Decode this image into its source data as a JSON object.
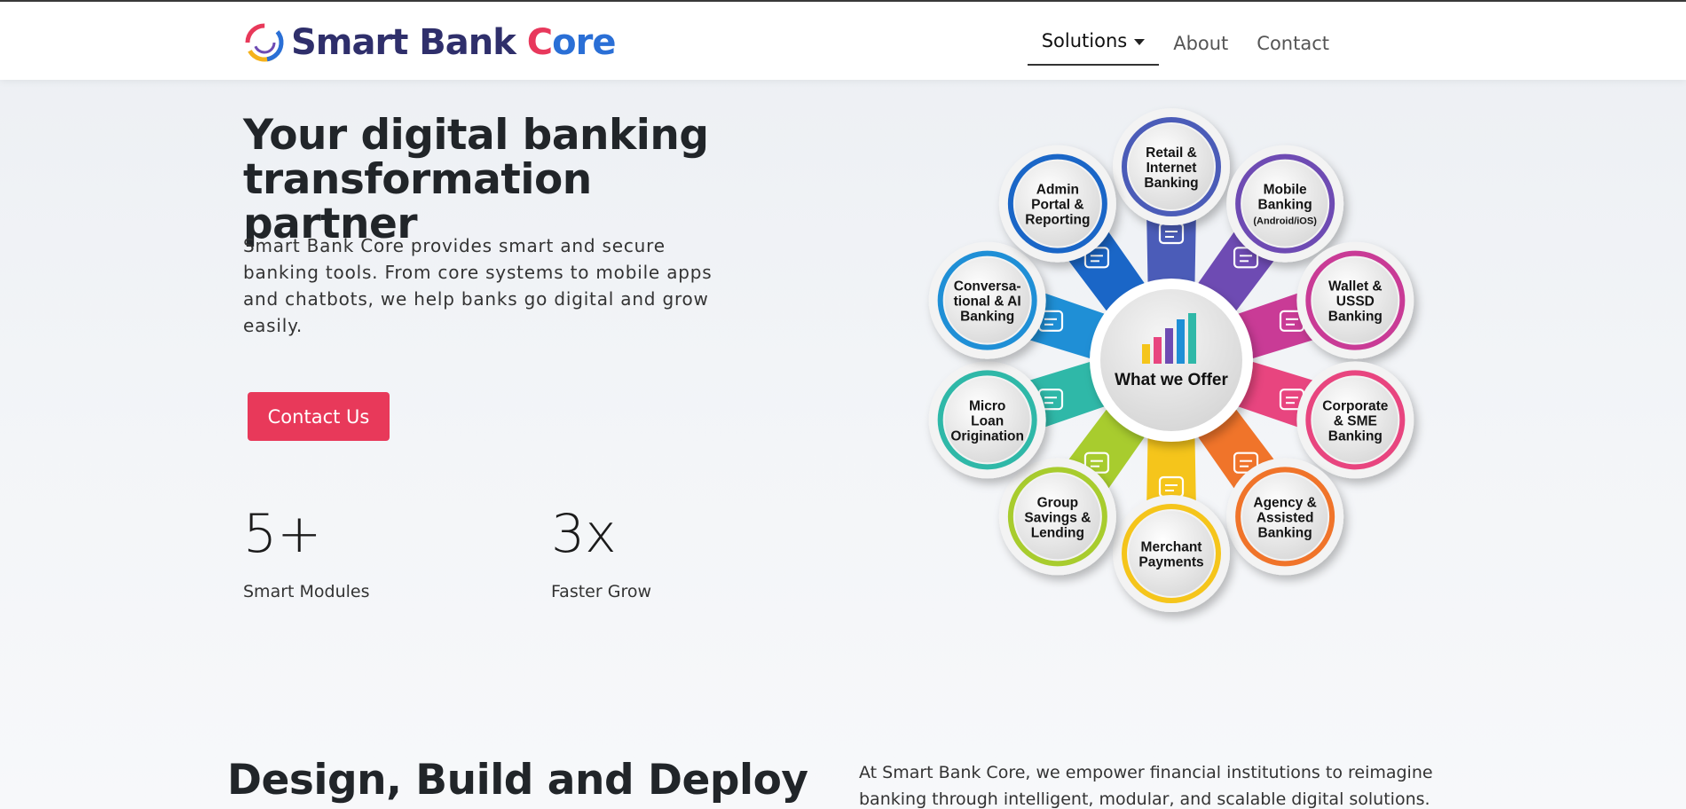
{
  "brand": {
    "name_part1": "Smart Bank ",
    "name_part2": "C",
    "name_part3": "ore",
    "logo_icon": "swirl-logo-icon"
  },
  "nav": {
    "items": [
      {
        "label": "Solutions",
        "active": true,
        "has_dropdown": true
      },
      {
        "label": "About",
        "active": false
      },
      {
        "label": "Contact",
        "active": false
      }
    ]
  },
  "hero": {
    "title": "Your digital banking transformation partner",
    "description": "Smart Bank Core provides smart and secure banking tools. From core systems to mobile apps and chatbots, we help banks go digital and grow easily.",
    "cta_label": "Contact Us"
  },
  "stats": [
    {
      "value": "5+",
      "label": "Smart Modules"
    },
    {
      "value": "3x",
      "label": "Faster Grow"
    }
  ],
  "offer": {
    "center_label": "What we Offer",
    "items": [
      {
        "label": [
          "Retail &",
          "Internet",
          "Banking"
        ],
        "color": "#4b5cb8",
        "icon": "laptop-icon"
      },
      {
        "label": [
          "Mobile",
          "Banking",
          "(Android/iOS)"
        ],
        "color": "#6e4bb3",
        "icon": "mobile-check-icon"
      },
      {
        "label": [
          "Wallet &",
          "USSD",
          "Banking"
        ],
        "color": "#c93b96",
        "icon": "wallet-icon"
      },
      {
        "label": [
          "Corporate",
          "& SME",
          "Banking"
        ],
        "color": "#e8457f",
        "icon": "building-icon"
      },
      {
        "label": [
          "Agency &",
          "Assisted",
          "Banking"
        ],
        "color": "#f0742a",
        "icon": "document-pen-icon"
      },
      {
        "label": [
          "Merchant",
          "Payments"
        ],
        "color": "#f5c51b",
        "icon": "card-icon"
      },
      {
        "label": [
          "Group",
          "Savings &",
          "Lending"
        ],
        "color": "#a8cc2e",
        "icon": "group-icon"
      },
      {
        "label": [
          "Micro",
          "Loan",
          "Origination"
        ],
        "color": "#2fb8a8",
        "icon": "loan-document-icon"
      },
      {
        "label": [
          "Conversa-",
          "tional & AI",
          "Banking"
        ],
        "color": "#1f8fd6",
        "icon": "chat-sparkle-icon"
      },
      {
        "label": [
          "Admin",
          "Portal &",
          "Reporting"
        ],
        "color": "#1a66c7",
        "icon": "user-gear-icon"
      }
    ]
  },
  "section2": {
    "title": "Design, Build and Deploy",
    "description": "At Smart Bank Core, we empower financial institutions to reimagine banking through intelligent, modular, and scalable digital solutions."
  }
}
